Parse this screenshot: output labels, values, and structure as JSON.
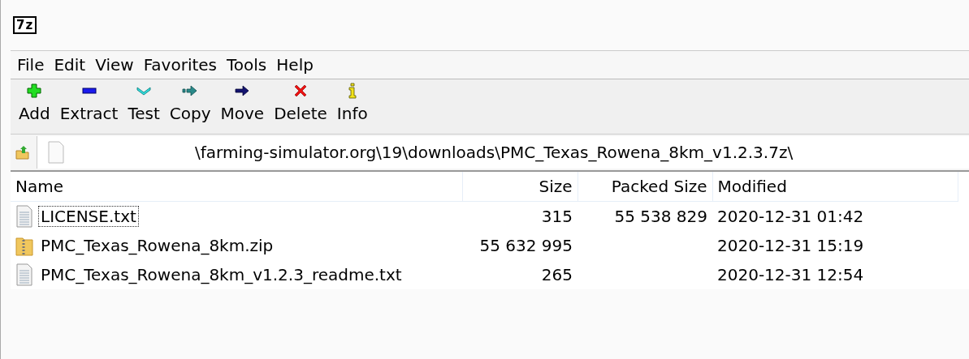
{
  "window": {
    "logo": "7z"
  },
  "menu": [
    "File",
    "Edit",
    "View",
    "Favorites",
    "Tools",
    "Help"
  ],
  "toolbar": [
    {
      "label": "Add",
      "kind": "add"
    },
    {
      "label": "Extract",
      "kind": "extract"
    },
    {
      "label": "Test",
      "kind": "test"
    },
    {
      "label": "Copy",
      "kind": "copy"
    },
    {
      "label": "Move",
      "kind": "move"
    },
    {
      "label": "Delete",
      "kind": "delete"
    },
    {
      "label": "Info",
      "kind": "info"
    }
  ],
  "address": {
    "value": "\\farming-simulator.org\\19\\downloads\\PMC_Texas_Rowena_8km_v1.2.3.7z\\"
  },
  "table": {
    "columns": [
      "Name",
      "Size",
      "Packed Size",
      "Modified"
    ],
    "rows": [
      {
        "kind": "text",
        "name": "LICENSE.txt",
        "size": "315",
        "packed_size": "55 538 829",
        "modified": "2020-12-31 01:42",
        "focused": true
      },
      {
        "kind": "zip",
        "name": "PMC_Texas_Rowena_8km.zip",
        "size": "55 632 995",
        "modified": "2020-12-31 15:19",
        "focused": false
      },
      {
        "kind": "text",
        "name": "PMC_Texas_Rowena_8km_v1.2.3_readme.txt",
        "size": "265",
        "modified": "2020-12-31 12:54",
        "focused": false
      }
    ]
  }
}
